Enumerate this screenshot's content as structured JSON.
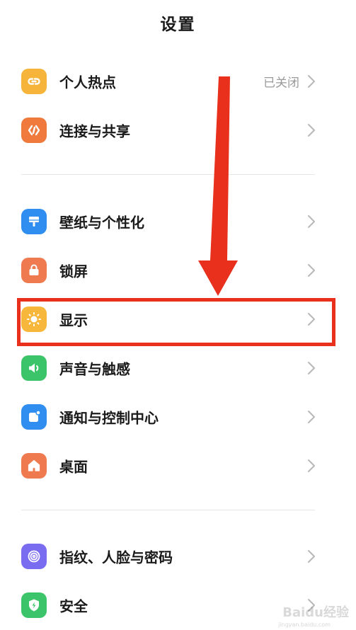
{
  "header": {
    "title": "设置"
  },
  "settings": {
    "hotspot": {
      "label": "个人热点",
      "value": "已关闭",
      "icon": "hotspot-link-icon",
      "color": "#f6b53a"
    },
    "connection": {
      "label": "连接与共享",
      "icon": "connection-share-icon",
      "color": "#f07a3e"
    },
    "wallpaper": {
      "label": "壁纸与个性化",
      "icon": "wallpaper-brush-icon",
      "color": "#2f8ef0"
    },
    "lockscreen": {
      "label": "锁屏",
      "icon": "lock-bag-icon",
      "color": "#f07a50"
    },
    "display": {
      "label": "显示",
      "icon": "sun-icon",
      "color": "#f7b73b"
    },
    "sound": {
      "label": "声音与触感",
      "icon": "speaker-icon",
      "color": "#3cc46a"
    },
    "notification": {
      "label": "通知与控制中心",
      "icon": "notification-icon",
      "color": "#2f8ef0"
    },
    "desktop": {
      "label": "桌面",
      "icon": "home-icon",
      "color": "#f07a50"
    },
    "biometrics": {
      "label": "指纹、人脸与密码",
      "icon": "fingerprint-icon",
      "color": "#7a6cf0"
    },
    "security": {
      "label": "安全",
      "icon": "shield-bolt-icon",
      "color": "#3cc46a"
    }
  },
  "annotation": {
    "highlight_color": "#e8301c",
    "arrow_color": "#e8301c"
  },
  "watermark": {
    "text": "Baidu经验",
    "sub": "jingyan.baidu.com"
  }
}
